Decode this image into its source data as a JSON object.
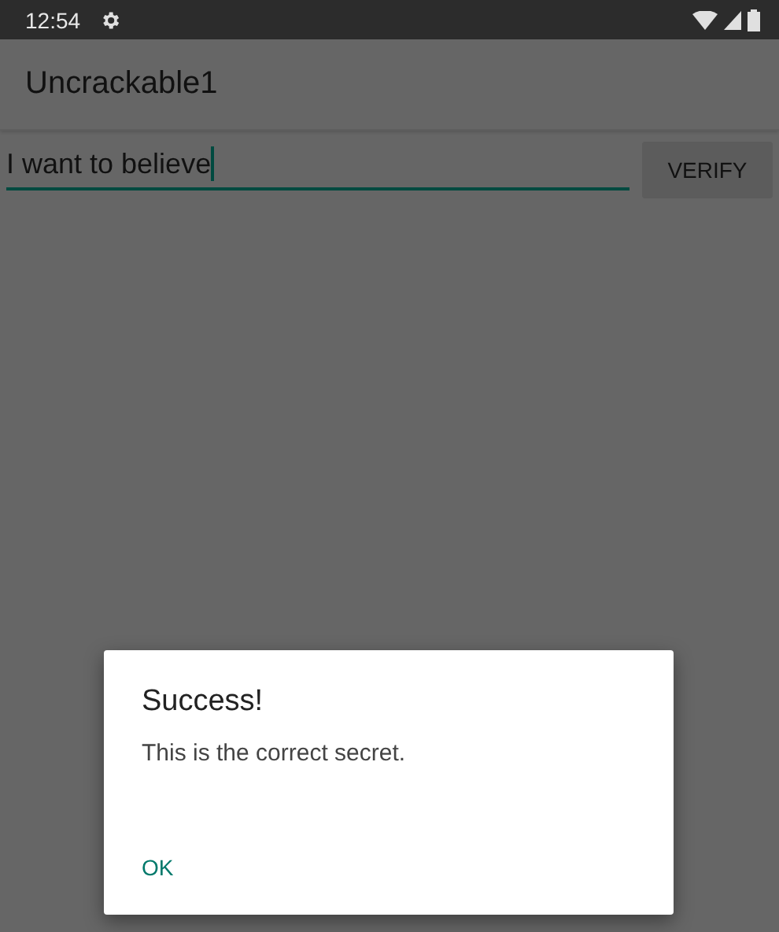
{
  "status_bar": {
    "time": "12:54"
  },
  "app_bar": {
    "title": "Uncrackable1"
  },
  "secret_field": {
    "value": "I want to believe"
  },
  "verify_button": {
    "label": "VERIFY"
  },
  "dialog": {
    "title": "Success!",
    "message": "This is the correct secret.",
    "buttons": [
      "OK"
    ]
  }
}
